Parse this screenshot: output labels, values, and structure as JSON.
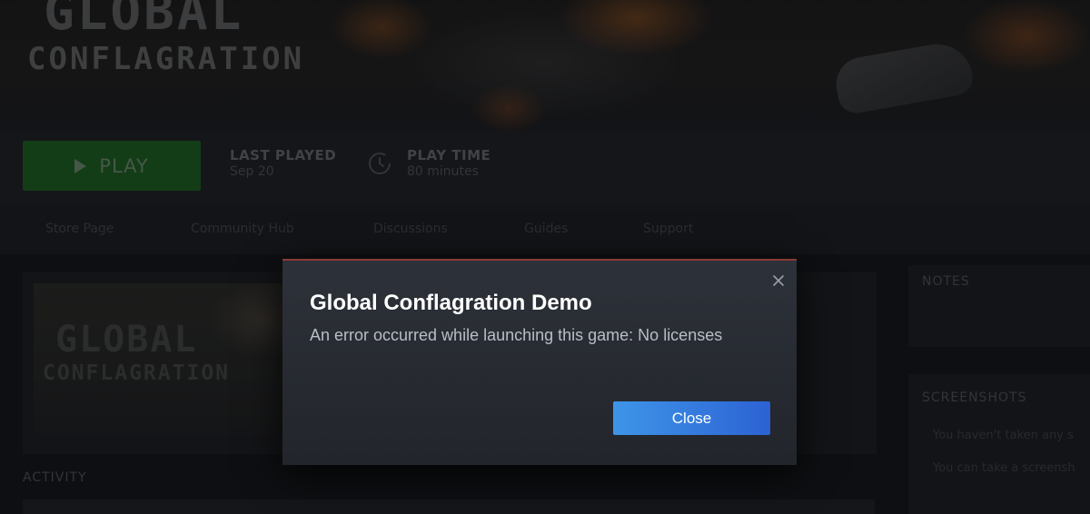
{
  "hero": {
    "logo_line1": "GLOBAL",
    "logo_line2": "CONFLAGRATION"
  },
  "playbar": {
    "play_label": "PLAY",
    "last_played_label": "LAST PLAYED",
    "last_played_value": "Sep 20",
    "play_time_label": "PLAY TIME",
    "play_time_value": "80 minutes"
  },
  "nav": {
    "items": [
      {
        "label": "Store Page"
      },
      {
        "label": "Community Hub"
      },
      {
        "label": "Discussions"
      },
      {
        "label": "Guides"
      },
      {
        "label": "Support"
      }
    ]
  },
  "content": {
    "thumb_logo_line1": "GLOBAL",
    "thumb_logo_line2": "CONFLAGRATION",
    "activity_title": "ACTIVITY"
  },
  "side": {
    "notes_title": "NOTES",
    "screenshots_title": "SCREENSHOTS",
    "screenshots_line1": "You haven't taken any s",
    "screenshots_line2": "You can take a screensh"
  },
  "modal": {
    "title": "Global Conflagration Demo",
    "message": "An error occurred while launching this game: No licenses",
    "close_button": "Close"
  },
  "colors": {
    "play_green": "#1c5b22",
    "button_blue_start": "#3e95e8",
    "button_blue_end": "#2c62d4",
    "modal_accent": "#8a3a34"
  },
  "icons": {
    "play": "play-icon",
    "clock": "clock-icon",
    "close": "close-icon"
  }
}
